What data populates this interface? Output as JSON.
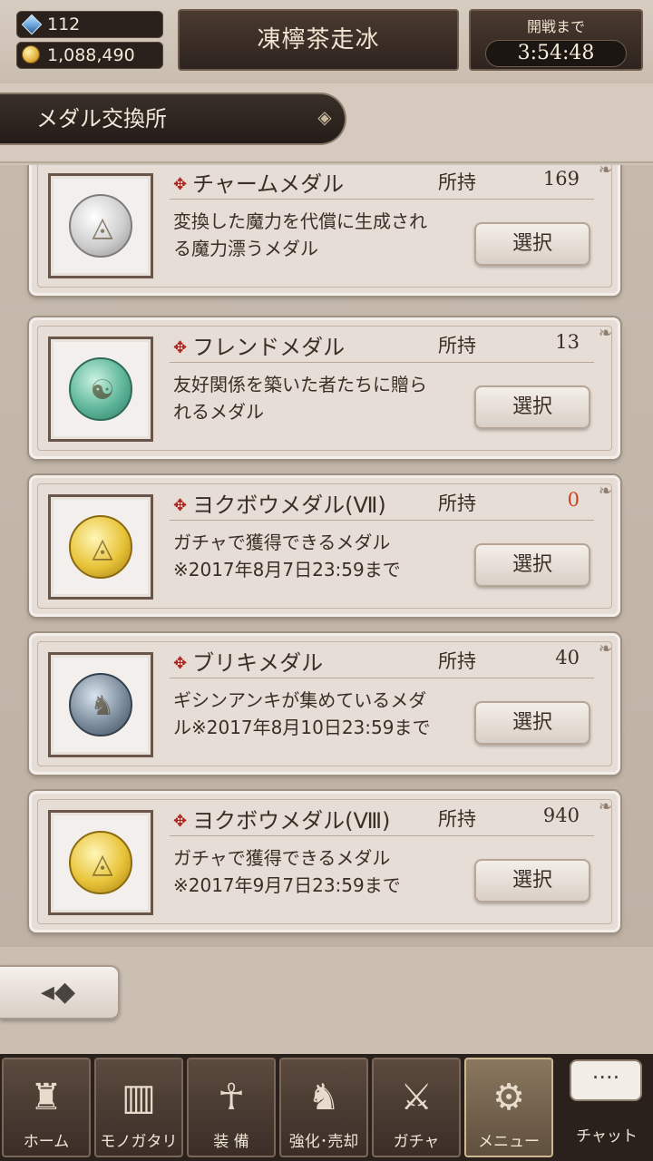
{
  "top_bar": {
    "gems": "112",
    "coins": "1,088,490",
    "title": "凍檸茶走冰",
    "timer_label": "開戦まで",
    "timer_value": "3:54:48"
  },
  "header": {
    "page_title": "メダル交換所"
  },
  "owned_label": "所持",
  "select_label": "選択",
  "medals": [
    {
      "name": "チャームメダル",
      "count": "169",
      "desc_1": "変換した魔力を代償に生成され",
      "desc_2": "る魔力漂うメダル",
      "color": "silver",
      "icon": "eye-triangle-icon"
    },
    {
      "name": "フレンドメダル",
      "count": "13",
      "desc_1": "友好関係を築いた者たちに贈ら",
      "desc_2": "れるメダル",
      "color": "green",
      "icon": "twin-faces-icon"
    },
    {
      "name": "ヨクボウメダル(Ⅶ)",
      "count": "0",
      "desc_1": "ガチャで獲得できるメダル",
      "desc_2": "※2017年8月7日23:59まで",
      "color": "gold",
      "icon": "eye-triangle-icon"
    },
    {
      "name": "ブリキメダル",
      "count": "40",
      "desc_1": "ギシンアンキが集めているメダ",
      "desc_2": "ル※2017年8月10日23:59まで",
      "color": "tin",
      "icon": "tin-soldier-icon"
    },
    {
      "name": "ヨクボウメダル(Ⅷ)",
      "count": "940",
      "desc_1": "ガチャで獲得できるメダル",
      "desc_2": "※2017年9月7日23:59まで",
      "color": "gold",
      "icon": "eye-triangle-icon"
    }
  ],
  "nav": [
    {
      "label": "ホーム",
      "icon": "castle-icon"
    },
    {
      "label": "モノガタリ",
      "icon": "book-icon"
    },
    {
      "label": "装 備",
      "icon": "puppet-icon"
    },
    {
      "label": "強化･売却",
      "icon": "shield-horse-icon"
    },
    {
      "label": "ガチャ",
      "icon": "crossed-swords-icon"
    },
    {
      "label": "メニュー",
      "icon": "gears-icon"
    }
  ],
  "chat": {
    "label": "チャット",
    "bubble": "····"
  }
}
